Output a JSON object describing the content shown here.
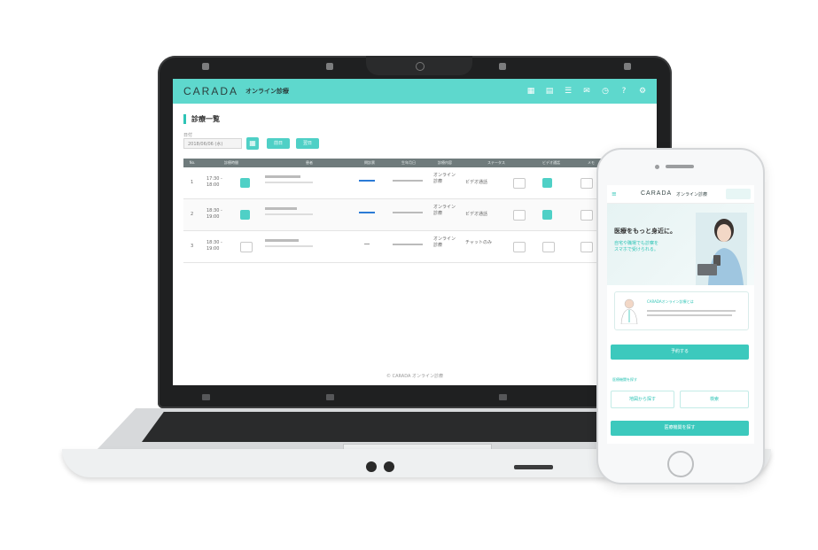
{
  "laptop": {
    "app": {
      "brand": "CARADA",
      "brand_sub": "オンライン診療",
      "header_icons": [
        "calendar-icon",
        "document-icon",
        "list-icon",
        "mail-icon",
        "clock-icon",
        "help-icon",
        "gear-icon"
      ]
    },
    "page": {
      "title": "診療一覧",
      "date_label": "日付",
      "date_value": "2018/06/06 (水)",
      "buttons": [
        "前日",
        "翌日"
      ]
    },
    "table": {
      "headers": [
        "No.",
        "診療時間",
        "患者",
        "問診票",
        "生年月日",
        "診療内容",
        "ステータス",
        "ビデオ通話",
        "メモ"
      ],
      "rows": [
        {
          "no": "1",
          "time": "17:30 - 18:00",
          "status": "オンライン診療",
          "type": "ビデオ通話"
        },
        {
          "no": "2",
          "time": "18:30 - 19:00",
          "status": "オンライン診療",
          "type": "ビデオ通話"
        },
        {
          "no": "3",
          "time": "18:30 - 19:00",
          "status": "オンライン診療",
          "type": "チャットのみ"
        }
      ]
    },
    "footer": "© CARADA オンライン診療"
  },
  "phone": {
    "brand": "CARADA",
    "brand_sub": "オンライン診療",
    "hero_title": "医療をもっと身近に。",
    "hero_sub1": "自宅や職場でも診察を",
    "hero_sub2": "スマホで受けられる。",
    "info_title": "CARADAオンライン診療とは",
    "btn_primary": "予約する",
    "section_label": "医療機関を探す",
    "btn_outline_1": "地図から探す",
    "btn_outline_2": "検索",
    "btn_bottom": "医療機関を探す"
  },
  "colors": {
    "accent": "#5ed8cd",
    "accent_dark": "#2ec4b6",
    "laptop_bezel": "#1f2021",
    "table_header": "#6f7b7c"
  }
}
